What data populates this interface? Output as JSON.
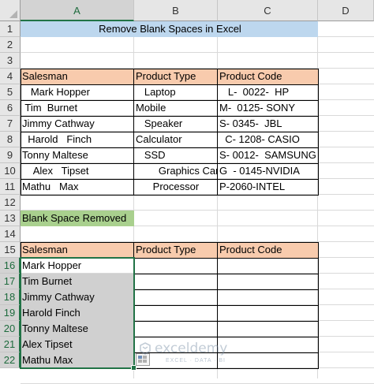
{
  "columns": [
    "A",
    "B",
    "C",
    "D"
  ],
  "rows": [
    "1",
    "2",
    "3",
    "4",
    "5",
    "6",
    "7",
    "8",
    "9",
    "10",
    "11",
    "12",
    "13",
    "14",
    "15",
    "16",
    "17",
    "18",
    "19",
    "20",
    "21",
    "22"
  ],
  "title": "Remove Blank Spaces in Excel",
  "table1": {
    "headers": [
      "Salesman",
      "Product Type",
      "Product Code"
    ],
    "rows": [
      [
        "   Mark Hopper",
        "   Laptop",
        "   L-  0022-  HP"
      ],
      [
        " Tim  Burnet",
        "Mobile",
        "M-  0125- SONY"
      ],
      [
        "Jimmy Cathway",
        "   Speaker",
        "S- 0345-  JBL"
      ],
      [
        "  Harold   Finch",
        "Calculator",
        "  C- 1208- CASIO"
      ],
      [
        "Tonny Maltese",
        "   SSD",
        "S- 0012-  SAMSUNG"
      ],
      [
        "    Alex   Tipset",
        "        Graphics Card",
        "G  - 0145-NVIDIA"
      ],
      [
        "Mathu   Max",
        "      Processor",
        "P-2060-INTEL"
      ]
    ]
  },
  "section_label": "Blank Space Removed",
  "table2": {
    "headers": [
      "Salesman",
      "Product Type",
      "Product Code"
    ],
    "names": [
      "Mark Hopper",
      "Tim Burnet",
      "Jimmy Cathway",
      "Harold Finch",
      "Tonny Maltese",
      "Alex Tipset",
      "Mathu Max"
    ]
  },
  "watermark": {
    "brand": "exceldemy",
    "tagline": "EXCEL · DATA · BI"
  },
  "colors": {
    "title_bg": "#bdd7ee",
    "header_bg": "#f8cbad",
    "label_bg": "#a9d08e",
    "selection": "#217346"
  }
}
